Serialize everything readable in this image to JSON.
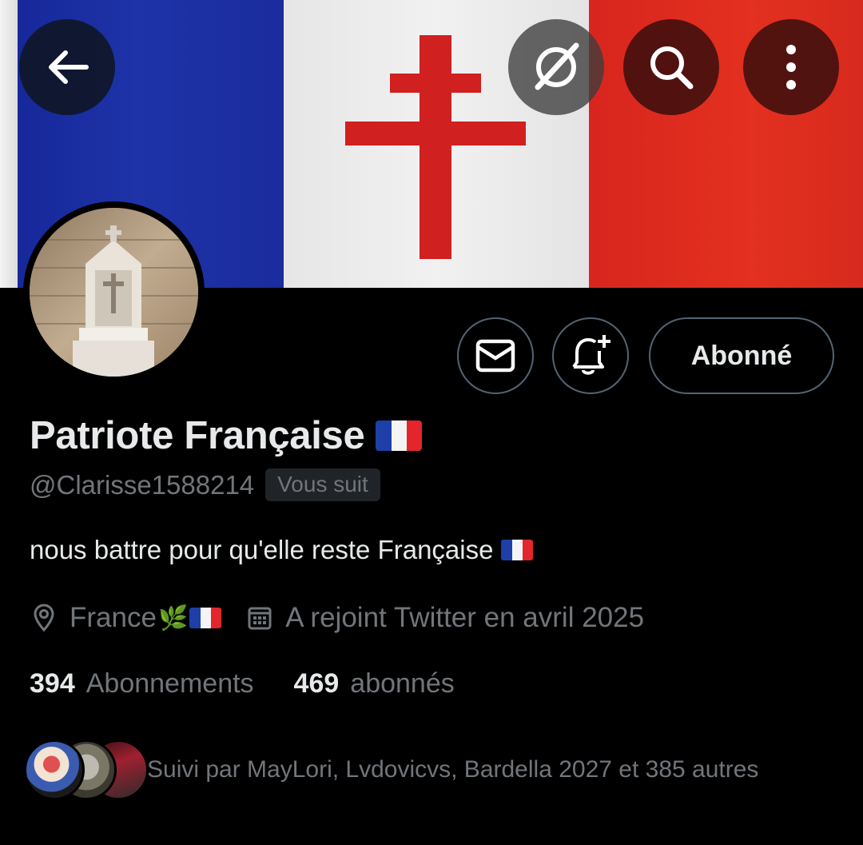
{
  "header": {
    "back_icon": "arrow-left-icon",
    "grok_icon": "grok-icon",
    "search_icon": "search-icon",
    "more_icon": "more-vertical-icon"
  },
  "banner": {
    "description_colors": {
      "blue": "#1e33a8",
      "white": "#f1f1f1",
      "red": "#e3301f",
      "cross": "#d0201f"
    }
  },
  "profile": {
    "display_name": "Patriote Française",
    "handle": "@Clarisse1588214",
    "follows_you_badge": "Vous suit",
    "bio": "nous battre pour qu'elle reste Française",
    "location": "France",
    "joined": "A rejoint Twitter en avril 2025"
  },
  "actions": {
    "message_icon": "mail-icon",
    "notify_icon": "bell-plus-icon",
    "following_label": "Abonné"
  },
  "stats": {
    "following_count": "394",
    "following_label": "Abonnements",
    "followers_count": "469",
    "followers_label": "abonnés"
  },
  "followed_by": {
    "text": "Suivi par MayLori, Lvdovicvs, Bardella 2027 et 385 autres"
  },
  "colors": {
    "background": "#000000",
    "text_primary": "#e7e9ea",
    "text_secondary": "#71767b",
    "border": "#536471"
  }
}
